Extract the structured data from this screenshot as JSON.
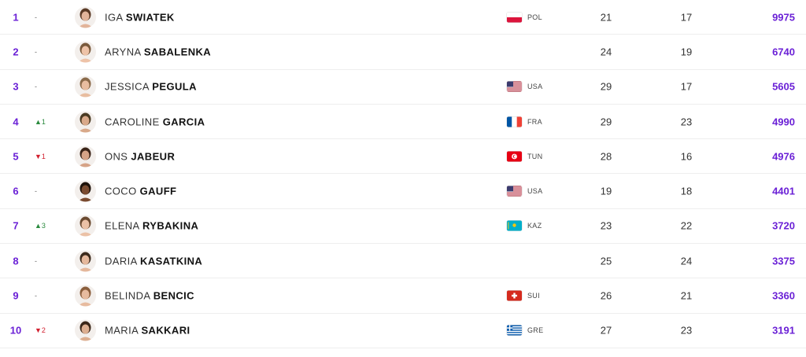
{
  "rankings": [
    {
      "rank": "1",
      "movement": "-",
      "movement_dir": "none",
      "first_name": "IGA",
      "last_name": "SWIATEK",
      "flag": "poland",
      "country": "POL",
      "tournaments": "21",
      "wins": "17",
      "points": "9975",
      "skin": "#e2b49a",
      "hair": "#5a3a26"
    },
    {
      "rank": "2",
      "movement": "-",
      "movement_dir": "none",
      "first_name": "ARYNA",
      "last_name": "SABALENKA",
      "flag": "",
      "country": "",
      "tournaments": "24",
      "wins": "19",
      "points": "6740",
      "skin": "#eec3a8",
      "hair": "#7a5a3c"
    },
    {
      "rank": "3",
      "movement": "-",
      "movement_dir": "none",
      "first_name": "JESSICA",
      "last_name": "PEGULA",
      "flag": "usa",
      "country": "USA",
      "tournaments": "29",
      "wins": "17",
      "points": "5605",
      "skin": "#e8bda0",
      "hair": "#8a6a4a"
    },
    {
      "rank": "4",
      "movement": "▲1",
      "movement_dir": "up",
      "first_name": "CAROLINE",
      "last_name": "GARCIA",
      "flag": "france",
      "country": "FRA",
      "tournaments": "29",
      "wins": "23",
      "points": "4990",
      "skin": "#d9a98a",
      "hair": "#4a3a22"
    },
    {
      "rank": "5",
      "movement": "▼1",
      "movement_dir": "down",
      "first_name": "ONS",
      "last_name": "JABEUR",
      "flag": "tunisia",
      "country": "TUN",
      "tournaments": "28",
      "wins": "16",
      "points": "4976",
      "skin": "#d6a387",
      "hair": "#3a2418"
    },
    {
      "rank": "6",
      "movement": "-",
      "movement_dir": "none",
      "first_name": "COCO",
      "last_name": "GAUFF",
      "flag": "usa",
      "country": "USA",
      "tournaments": "19",
      "wins": "18",
      "points": "4401",
      "skin": "#7a4b30",
      "hair": "#1e120a"
    },
    {
      "rank": "7",
      "movement": "▲3",
      "movement_dir": "up",
      "first_name": "ELENA",
      "last_name": "RYBAKINA",
      "flag": "kazakhstan",
      "country": "KAZ",
      "tournaments": "23",
      "wins": "22",
      "points": "3720",
      "skin": "#ebc1a6",
      "hair": "#6a4a30"
    },
    {
      "rank": "8",
      "movement": "-",
      "movement_dir": "none",
      "first_name": "DARIA",
      "last_name": "KASATKINA",
      "flag": "",
      "country": "",
      "tournaments": "25",
      "wins": "24",
      "points": "3375",
      "skin": "#e5b89c",
      "hair": "#3c2a1c"
    },
    {
      "rank": "9",
      "movement": "-",
      "movement_dir": "none",
      "first_name": "BELINDA",
      "last_name": "BENCIC",
      "flag": "switzerland",
      "country": "SUI",
      "tournaments": "26",
      "wins": "21",
      "points": "3360",
      "skin": "#e7bb9f",
      "hair": "#8a5e3c"
    },
    {
      "rank": "10",
      "movement": "▼2",
      "movement_dir": "down",
      "first_name": "MARIA",
      "last_name": "SAKKARI",
      "flag": "greece",
      "country": "GRE",
      "tournaments": "27",
      "wins": "23",
      "points": "3191",
      "skin": "#dcae90",
      "hair": "#3a2618"
    }
  ],
  "colors": {
    "accent": "#6b21d6",
    "up": "#2a8a3e",
    "down": "#d21f2f"
  }
}
